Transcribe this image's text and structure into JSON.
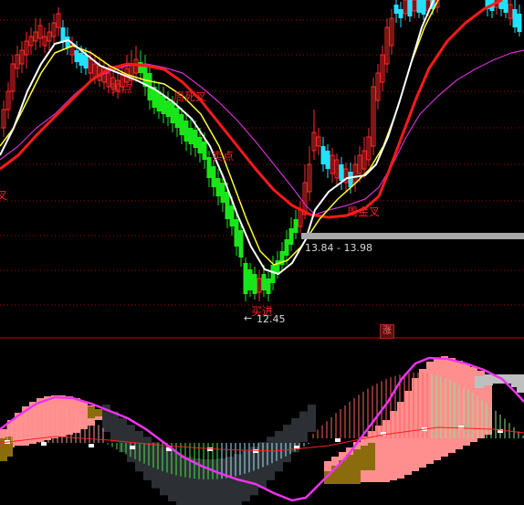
{
  "annotations": {
    "buy_signal_1": "买点",
    "weekly_death_cross": "周死叉",
    "sell_point": "卖点",
    "weekly_golden_cross": "周金叉",
    "buy_signal_2": "买进",
    "left_edge_cut": "叉"
  },
  "price_band_label": "13.84 - 13.98",
  "low_price_label": "12.45",
  "low_price_arrow": "←",
  "rise_badge": "涨",
  "colors": {
    "background": "#000000",
    "up_candle": "#ff2a2a",
    "down_candle_cyan": "#22e0ff",
    "down_candle_green": "#19e619",
    "ma_white": "#ffffff",
    "ma_yellow": "#ffff33",
    "ma_red": "#ff1a1a",
    "ma_magenta": "#cc33cc",
    "grid_red": "#aa0000",
    "panel_divider": "#cc0000",
    "osc_pink": "#ff8f8f",
    "osc_dark": "#2c2f33",
    "osc_olive": "#8b6c0c",
    "osc_grey": "#bfbfbf",
    "osc_magenta_line": "#ee33ee",
    "annotation_text": "#ff2020",
    "price_band": "#a9a9a9"
  }
}
